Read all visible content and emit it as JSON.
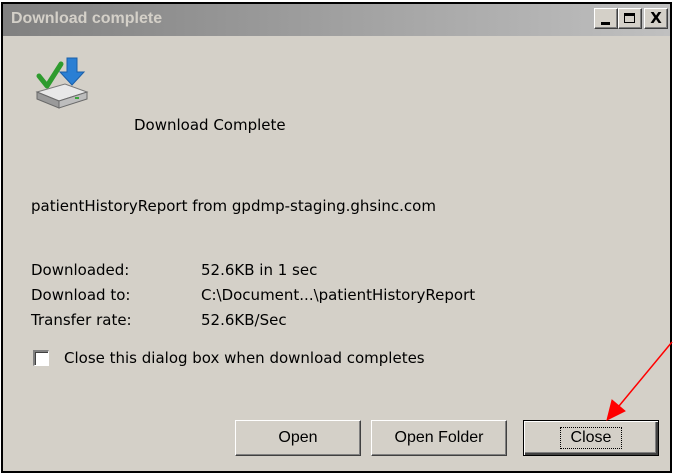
{
  "window": {
    "title": "Download complete",
    "controls": {
      "minimize_icon": "minimize-icon",
      "maximize_icon": "maximize-icon",
      "close_glyph": "X"
    }
  },
  "status": {
    "icon": "download-complete-icon",
    "heading": "Download Complete"
  },
  "file": {
    "source_line": "patientHistoryReport from gpdmp-staging.ghsinc.com"
  },
  "details": [
    {
      "label": "Downloaded:",
      "value": "52.6KB in 1 sec"
    },
    {
      "label": "Download to:",
      "value": "C:\\Document...\\patientHistoryReport"
    },
    {
      "label": "Transfer rate:",
      "value": "52.6KB/Sec"
    }
  ],
  "options": {
    "close_when_done_label": "Close this dialog box when download completes",
    "close_when_done_checked": false
  },
  "buttons": {
    "open": "Open",
    "open_folder": "Open Folder",
    "close": "Close"
  },
  "annotation": {
    "arrow_color": "#ff0000",
    "points_to": "close-button"
  },
  "colors": {
    "dialog_bg": "#d4d0c8",
    "titlebar_start": "#808080",
    "titlebar_end": "#c0c0c0",
    "title_text": "#d4d0c8"
  }
}
